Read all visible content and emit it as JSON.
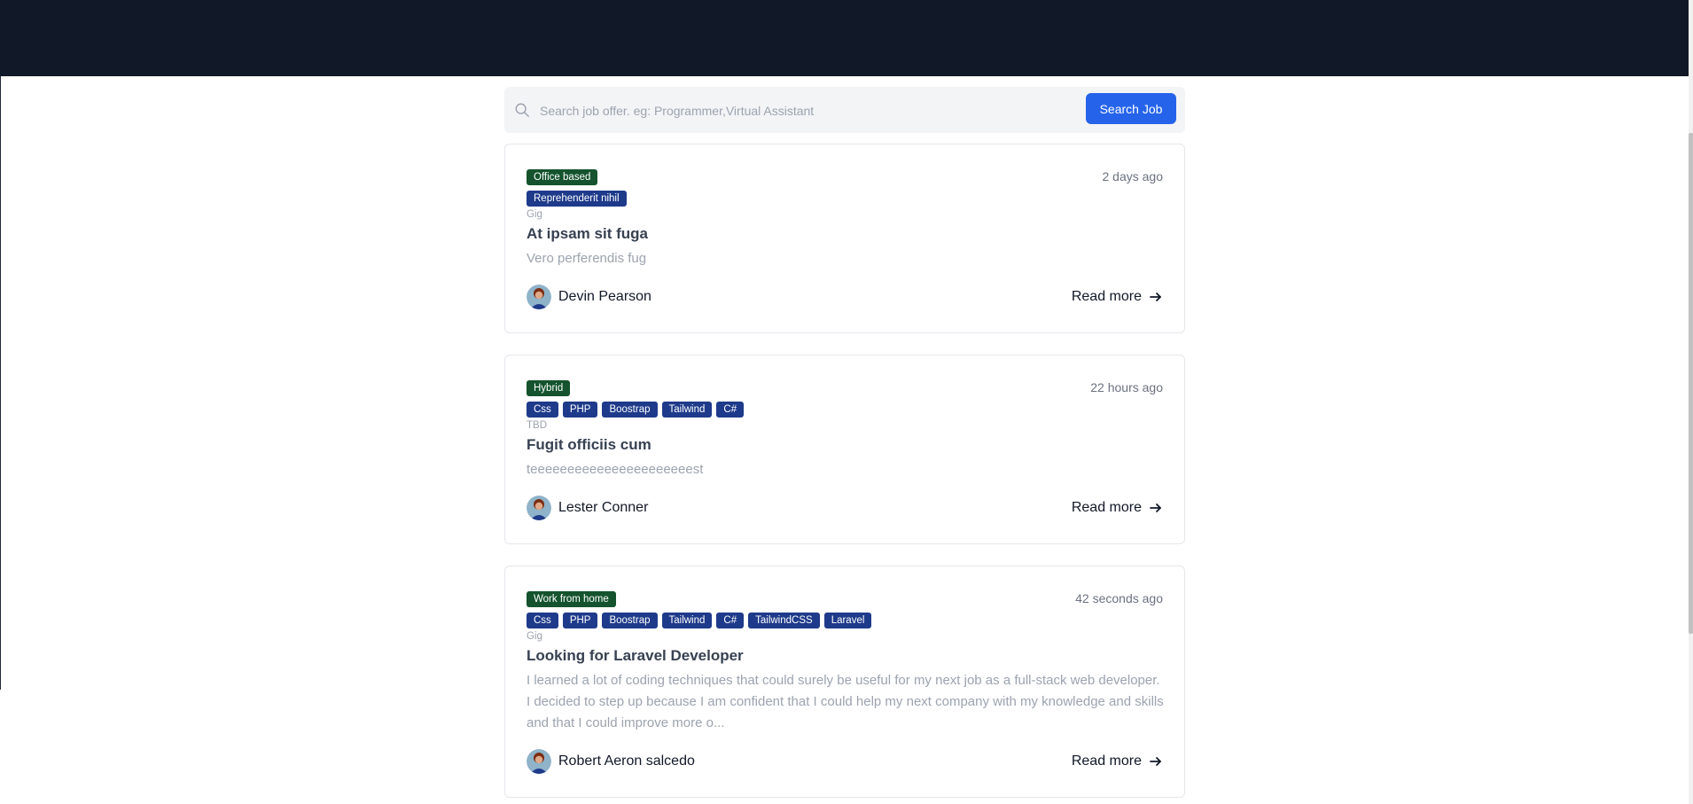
{
  "search": {
    "placeholder": "Search job offer. eg: Programmer,Virtual Assistant",
    "value": "",
    "button_label": "Search Job"
  },
  "colors": {
    "topbar": "#111827",
    "primary_button": "#2563eb",
    "tag_location": "#14532d",
    "tag_skill": "#1e3a8a"
  },
  "jobs": [
    {
      "location_tag": "Office based",
      "skill_tags": [
        "Reprehenderit nihil"
      ],
      "time_ago": "2 days ago",
      "type": "Gig",
      "title": "At ipsam sit fuga",
      "description": "Vero perferendis fug",
      "author": "Devin Pearson",
      "read_more": "Read more"
    },
    {
      "location_tag": "Hybrid",
      "skill_tags": [
        "Css",
        "PHP",
        "Boostrap",
        "Tailwind",
        "C#"
      ],
      "time_ago": "22 hours ago",
      "type": "TBD",
      "title": "Fugit officiis cum",
      "description": "teeeeeeeeeeeeeeeeeeeeeest",
      "author": "Lester Conner",
      "read_more": "Read more"
    },
    {
      "location_tag": "Work from home",
      "skill_tags": [
        "Css",
        "PHP",
        "Boostrap",
        "Tailwind",
        "C#",
        "TailwindCSS",
        "Laravel"
      ],
      "time_ago": "42 seconds ago",
      "type": "Gig",
      "title": "Looking for Laravel Developer",
      "description": "I learned a lot of coding techniques that could surely be useful for my next job as a full-stack web developer. I decided to step up because I am confident that I could help my next company with my knowledge and skills and that I could improve more o...",
      "author": "Robert Aeron salcedo",
      "read_more": "Read more"
    }
  ]
}
